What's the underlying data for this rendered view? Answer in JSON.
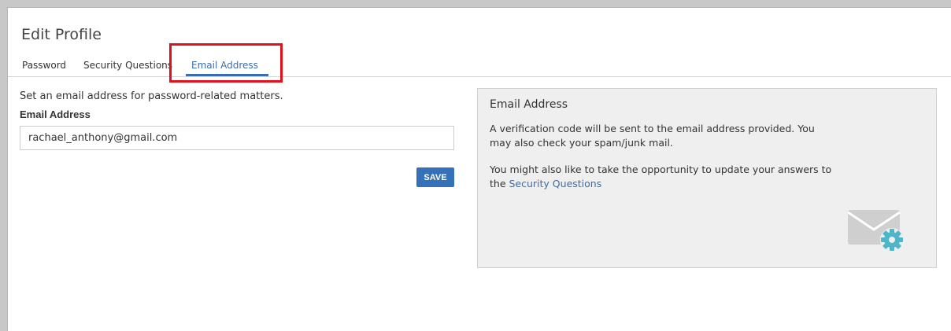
{
  "page": {
    "title": "Edit Profile"
  },
  "tabs": [
    {
      "label": "Password"
    },
    {
      "label": "Security Questions"
    },
    {
      "label": "Email Address",
      "active": true
    }
  ],
  "form": {
    "description": "Set an email address for password-related matters.",
    "email_label": "Email Address",
    "email_value": "rachael_anthony@gmail.com",
    "save_label": "SAVE"
  },
  "info": {
    "title": "Email Address",
    "paragraph1": "A verification code will be sent to the email address provided. You may also check your spam/junk mail.",
    "paragraph2_prefix": "You might also like to take the opportunity to update your answers to the ",
    "paragraph2_link": "Security Questions",
    "icon": "envelope-gear-icon"
  },
  "colors": {
    "accent": "#3a6db0",
    "save_button": "#3571b8",
    "highlight": "#e0111b",
    "gear": "#4db6c8",
    "envelope": "#cfcfcf"
  }
}
